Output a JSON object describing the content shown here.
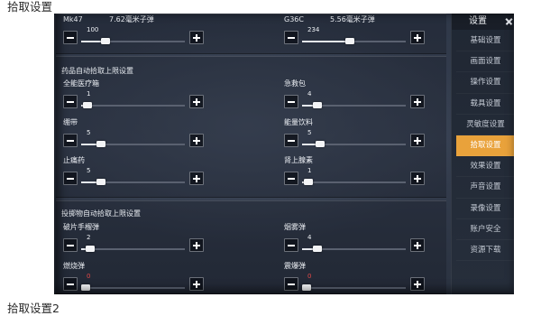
{
  "captions": {
    "top": "拾取设置",
    "bottom": "拾取设置2"
  },
  "colors": {
    "accent": "#e9a23b",
    "value_zero": "#e24848"
  },
  "icons": {
    "minus": "minus-icon",
    "plus": "plus-icon",
    "close": "close-icon"
  },
  "sidebar": {
    "title": "设置",
    "items": [
      {
        "label": "基础设置",
        "active": false
      },
      {
        "label": "画面设置",
        "active": false
      },
      {
        "label": "操作设置",
        "active": false
      },
      {
        "label": "载具设置",
        "active": false
      },
      {
        "label": "灵敏度设置",
        "active": false
      },
      {
        "label": "拾取设置",
        "active": true
      },
      {
        "label": "效果设置",
        "active": false
      },
      {
        "label": "声音设置",
        "active": false
      },
      {
        "label": "录像设置",
        "active": false
      },
      {
        "label": "账户安全",
        "active": false
      },
      {
        "label": "资源下载",
        "active": false
      }
    ]
  },
  "sections": {
    "weapons": {
      "items": [
        {
          "label": "Mk47",
          "ammo": "7.62毫米子弹",
          "value": 100,
          "level": 0.21
        },
        {
          "label": "G36C",
          "ammo": "5.56毫米子弹",
          "value": 234,
          "level": 0.46
        }
      ]
    },
    "medicine": {
      "title": "药品自动拾取上限设置",
      "items": [
        {
          "label": "全能医疗箱",
          "value": 1,
          "level": 0.02
        },
        {
          "label": "急救包",
          "value": 4,
          "level": 0.11
        },
        {
          "label": "绷带",
          "value": 5,
          "level": 0.16
        },
        {
          "label": "能量饮料",
          "value": 5,
          "level": 0.14
        },
        {
          "label": "止痛药",
          "value": 5,
          "level": 0.16
        },
        {
          "label": "肾上腺素",
          "value": 1,
          "level": 0.02
        }
      ]
    },
    "throwables": {
      "title": "投掷物自动拾取上限设置",
      "items": [
        {
          "label": "破片手榴弹",
          "value": 2,
          "level": 0.05
        },
        {
          "label": "烟雾弹",
          "value": 4,
          "level": 0.11
        },
        {
          "label": "燃烧弹",
          "value": 0,
          "level": 0,
          "value_color": "#e24848"
        },
        {
          "label": "震爆弹",
          "value": 0,
          "level": 0,
          "value_color": "#e24848"
        }
      ]
    }
  }
}
